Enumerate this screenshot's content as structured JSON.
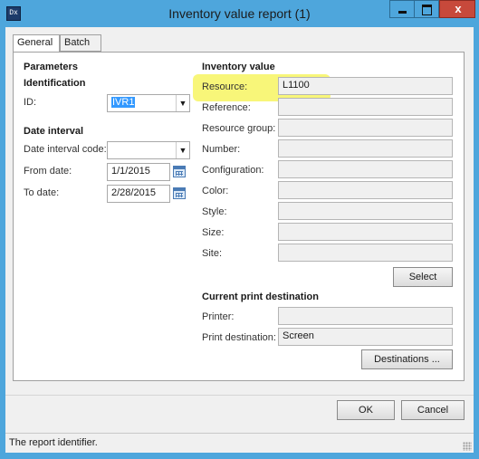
{
  "window": {
    "title": "Inventory value report (1)",
    "app_icon": "Dx",
    "close_glyph": "x"
  },
  "tabs": [
    {
      "label": "General",
      "active": true
    },
    {
      "label": "Batch",
      "active": false
    }
  ],
  "parameters": {
    "heading": "Parameters",
    "identification_heading": "Identification",
    "id_label": "ID:",
    "id_value": "IVR1"
  },
  "date_interval": {
    "heading": "Date interval",
    "code_label": "Date interval code:",
    "code_value": "",
    "from_label": "From date:",
    "from_value": "1/1/2015",
    "to_label": "To date:",
    "to_value": "2/28/2015"
  },
  "inventory_value": {
    "heading": "Inventory value",
    "fields": [
      {
        "label": "Resource:",
        "value": "L1100"
      },
      {
        "label": "Reference:",
        "value": ""
      },
      {
        "label": "Resource group:",
        "value": ""
      },
      {
        "label": "Number:",
        "value": ""
      },
      {
        "label": "Configuration:",
        "value": ""
      },
      {
        "label": "Color:",
        "value": ""
      },
      {
        "label": "Style:",
        "value": ""
      },
      {
        "label": "Size:",
        "value": ""
      },
      {
        "label": "Site:",
        "value": ""
      }
    ],
    "select_label": "Select"
  },
  "print_destination": {
    "heading": "Current print destination",
    "printer_label": "Printer:",
    "printer_value": "",
    "dest_label": "Print destination:",
    "dest_value": "Screen",
    "destinations_label": "Destinations ..."
  },
  "footer": {
    "ok_label": "OK",
    "cancel_label": "Cancel"
  },
  "status_bar": {
    "text": "The report identifier."
  },
  "colors": {
    "highlight": "#f7f56a",
    "title_bar": "#4ea6dc",
    "close_button": "#c7493b",
    "id_selection": "#3399ff"
  }
}
